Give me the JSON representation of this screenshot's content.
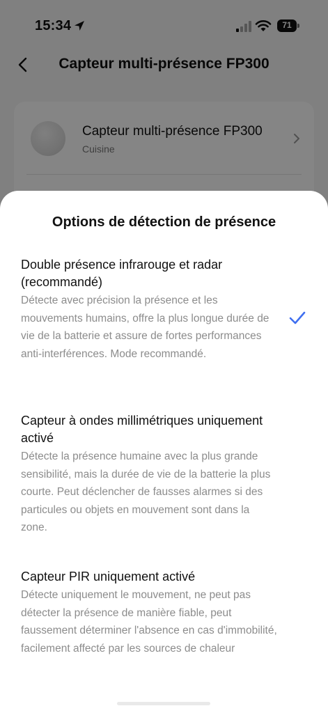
{
  "status": {
    "time": "15:34",
    "battery": "71",
    "icons": [
      "location-arrow-icon",
      "signal-icon",
      "wifi-icon",
      "battery-icon"
    ]
  },
  "nav": {
    "title": "Capteur multi-présence FP300",
    "back_icon": "chevron-left-icon"
  },
  "device": {
    "name": "Capteur multi-présence FP300",
    "room": "Cuisine"
  },
  "sheet": {
    "title": "Options de détection de présence",
    "options": [
      {
        "title": "Double présence infrarouge et radar (recommandé)",
        "description": "Détecte avec précision la présence et les mouvements humains, offre la plus longue durée de vie de la batterie et assure de fortes performances anti-interférences. Mode recommandé.",
        "selected": true
      },
      {
        "title": "Capteur à ondes millimétriques uniquement activé",
        "description": "Détecte la présence humaine avec la plus grande sensibilité, mais la durée de vie de la batterie la plus courte. Peut déclencher de fausses alarmes si des particules ou objets en mouvement sont dans la zone.",
        "selected": false
      },
      {
        "title": "Capteur PIR uniquement activé",
        "description": "Détecte uniquement le mouvement, ne peut pas détecter la présence de manière fiable, peut faussement déterminer l'absence en cas d'immobilité, facilement affecté par les sources de chaleur",
        "selected": false
      }
    ]
  },
  "colors": {
    "accent": "#3f6ff0",
    "title_text": "#111111",
    "description_text": "#8c8c8c",
    "sheet_background": "#ffffff"
  }
}
